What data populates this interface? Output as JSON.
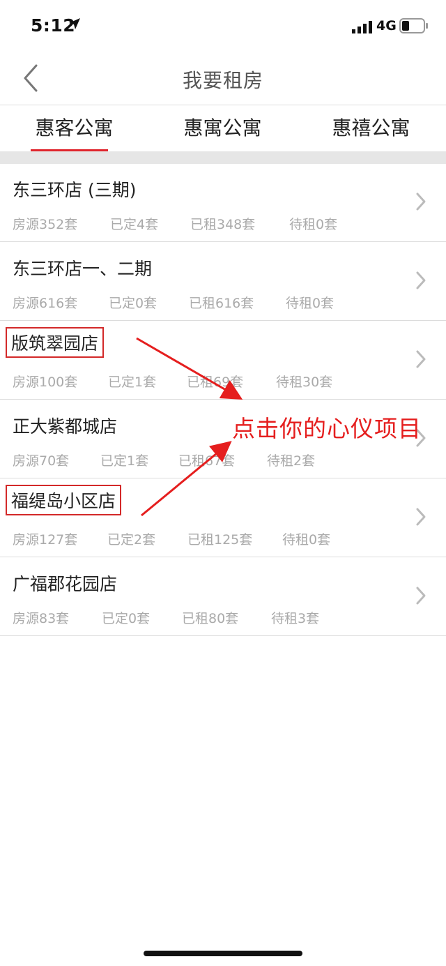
{
  "status": {
    "time": "5:12",
    "network": "4G"
  },
  "nav": {
    "title": "我要租房"
  },
  "tabs": [
    {
      "label": "惠客公寓",
      "active": true
    },
    {
      "label": "惠寓公寓",
      "active": false
    },
    {
      "label": "惠禧公寓",
      "active": false
    }
  ],
  "stores": [
    {
      "name": "东三环店 (三期)",
      "stats": [
        "房源352套",
        "已定4套",
        "已租348套",
        "待租0套"
      ]
    },
    {
      "name": "东三环店一、二期",
      "stats": [
        "房源616套",
        "已定0套",
        "已租616套",
        "待租0套"
      ]
    },
    {
      "name": "版筑翠园店",
      "stats": [
        "房源100套",
        "已定1套",
        "已租69套",
        "待租30套"
      ]
    },
    {
      "name": "正大紫都城店",
      "stats": [
        "房源70套",
        "已定1套",
        "已租67套",
        "待租2套"
      ]
    },
    {
      "name": "福缇岛小区店",
      "stats": [
        "房源127套",
        "已定2套",
        "已租125套",
        "待租0套"
      ]
    },
    {
      "name": "广福郡花园店",
      "stats": [
        "房源83套",
        "已定0套",
        "已租80套",
        "待租3套"
      ]
    }
  ],
  "annotation": {
    "text": "点击你的心仪项目"
  },
  "colors": {
    "accent": "#e0242c",
    "annotation": "#e51e1e",
    "muted_text": "#aaaaaa"
  },
  "icons": [
    "location-arrow-icon",
    "signal-icon",
    "battery-icon",
    "back-chevron-icon",
    "chevron-right-icon"
  ]
}
